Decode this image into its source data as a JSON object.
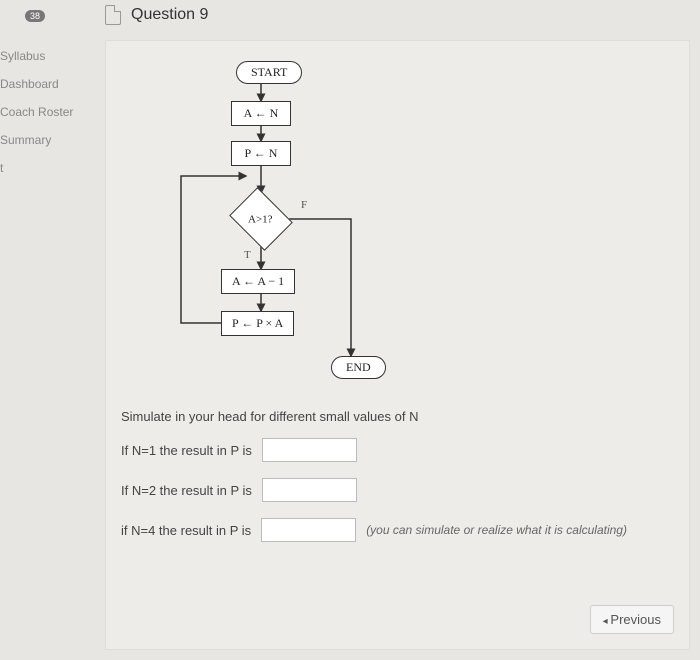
{
  "sidebar": {
    "badge": "38",
    "items": [
      {
        "label": "Syllabus"
      },
      {
        "label": "Dashboard"
      },
      {
        "label": "Coach Roster"
      },
      {
        "label": "Summary"
      },
      {
        "label": "t"
      }
    ]
  },
  "header": {
    "title": "Question 9"
  },
  "flowchart": {
    "start": "START",
    "step1": "A ← N",
    "step2": "P ← N",
    "decision": "A>1?",
    "label_f": "F",
    "label_t": "T",
    "step3": "A ← A − 1",
    "step4": "P ← P × A",
    "end": "END"
  },
  "instruction": "Simulate in your head for different small values of N",
  "questions": {
    "q1_label": "If N=1 the result in P is",
    "q1_value": "",
    "q2_label": "If N=2 the result in P is",
    "q2_value": "",
    "q3_label": "if N=4 the result in P is",
    "q3_value": "",
    "q3_hint": "(you can simulate or realize what it is calculating)"
  },
  "footer": {
    "prev": "Previous"
  }
}
